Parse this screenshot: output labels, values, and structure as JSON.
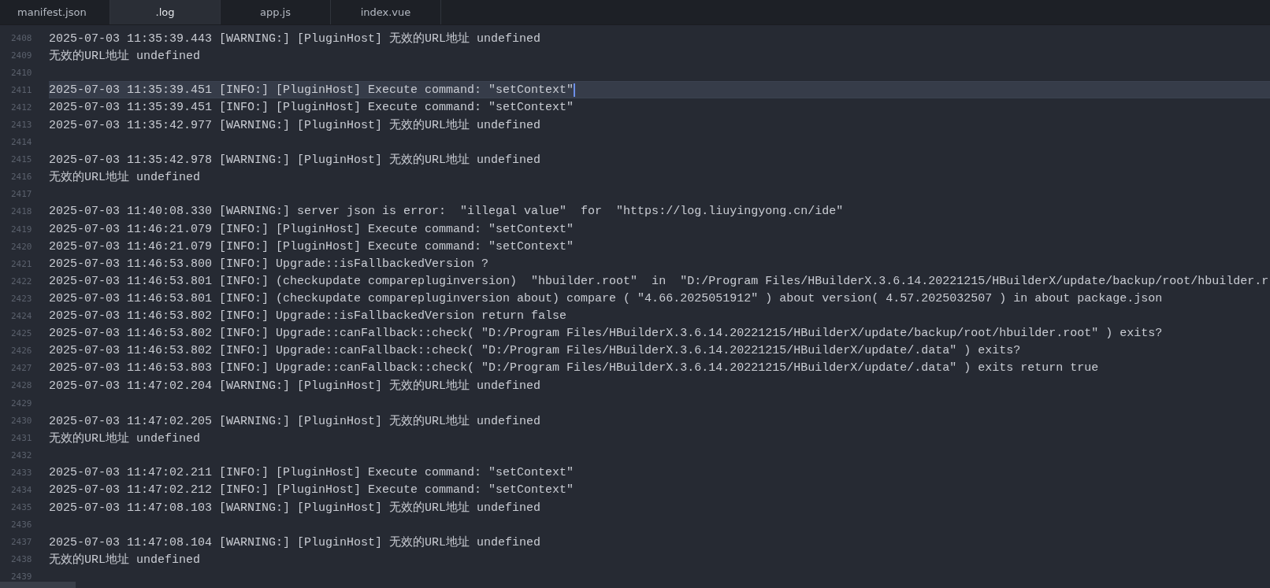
{
  "tabs": [
    {
      "label": "manifest.json",
      "selected": false
    },
    {
      "label": ".log",
      "selected": true
    },
    {
      "label": "app.js",
      "selected": false
    },
    {
      "label": "index.vue",
      "selected": false
    }
  ],
  "lines": [
    {
      "number": "2408",
      "text": "2025-07-03 11:35:39.443 [WARNING:] [PluginHost] 无效的URL地址 undefined",
      "current": false
    },
    {
      "number": "2409",
      "text": "无效的URL地址 undefined",
      "current": false
    },
    {
      "number": "2410",
      "current": false
    },
    {
      "number": "2411",
      "text": "2025-07-03 11:35:39.451 [INFO:] [PluginHost] Execute command: \"setContext\"",
      "current": true
    },
    {
      "number": "2412",
      "text": "2025-07-03 11:35:39.451 [INFO:] [PluginHost] Execute command: \"setContext\"",
      "current": false
    },
    {
      "number": "2413",
      "text": "2025-07-03 11:35:42.977 [WARNING:] [PluginHost] 无效的URL地址 undefined",
      "current": false
    },
    {
      "number": "2414",
      "current": false
    },
    {
      "number": "2415",
      "text": "2025-07-03 11:35:42.978 [WARNING:] [PluginHost] 无效的URL地址 undefined",
      "current": false
    },
    {
      "number": "2416",
      "text": "无效的URL地址 undefined",
      "current": false
    },
    {
      "number": "2417",
      "current": false
    },
    {
      "number": "2418",
      "text": "2025-07-03 11:40:08.330 [WARNING:] server json is error:  \"illegal value\"  for  \"https://log.liuyingyong.cn/ide\"",
      "current": false
    },
    {
      "number": "2419",
      "text": "2025-07-03 11:46:21.079 [INFO:] [PluginHost] Execute command: \"setContext\"",
      "current": false
    },
    {
      "number": "2420",
      "text": "2025-07-03 11:46:21.079 [INFO:] [PluginHost] Execute command: \"setContext\"",
      "current": false
    },
    {
      "number": "2421",
      "text": "2025-07-03 11:46:53.800 [INFO:] Upgrade::isFallbackedVersion ?",
      "current": false
    },
    {
      "number": "2422",
      "text": "2025-07-03 11:46:53.801 [INFO:] (checkupdate comparepluginversion)  \"hbuilder.root\"  in  \"D:/Program Files/HBuilderX.3.6.14.20221215/HBuilderX/update/backup/root/hbuilder.r",
      "current": false
    },
    {
      "number": "2423",
      "text": "2025-07-03 11:46:53.801 [INFO:] (checkupdate comparepluginversion about) compare ( \"4.66.2025051912\" ) about version( 4.57.2025032507 ) in about package.json",
      "current": false
    },
    {
      "number": "2424",
      "text": "2025-07-03 11:46:53.802 [INFO:] Upgrade::isFallbackedVersion return false",
      "current": false
    },
    {
      "number": "2425",
      "text": "2025-07-03 11:46:53.802 [INFO:] Upgrade::canFallback::check( \"D:/Program Files/HBuilderX.3.6.14.20221215/HBuilderX/update/backup/root/hbuilder.root\" ) exits?",
      "current": false
    },
    {
      "number": "2426",
      "text": "2025-07-03 11:46:53.802 [INFO:] Upgrade::canFallback::check( \"D:/Program Files/HBuilderX.3.6.14.20221215/HBuilderX/update/.data\" ) exits?",
      "current": false
    },
    {
      "number": "2427",
      "text": "2025-07-03 11:46:53.803 [INFO:] Upgrade::canFallback::check( \"D:/Program Files/HBuilderX.3.6.14.20221215/HBuilderX/update/.data\" ) exits return true",
      "current": false
    },
    {
      "number": "2428",
      "text": "2025-07-03 11:47:02.204 [WARNING:] [PluginHost] 无效的URL地址 undefined",
      "current": false
    },
    {
      "number": "2429",
      "current": false
    },
    {
      "number": "2430",
      "text": "2025-07-03 11:47:02.205 [WARNING:] [PluginHost] 无效的URL地址 undefined",
      "current": false
    },
    {
      "number": "2431",
      "text": "无效的URL地址 undefined",
      "current": false
    },
    {
      "number": "2432",
      "current": false
    },
    {
      "number": "2433",
      "text": "2025-07-03 11:47:02.211 [INFO:] [PluginHost] Execute command: \"setContext\"",
      "current": false
    },
    {
      "number": "2434",
      "text": "2025-07-03 11:47:02.212 [INFO:] [PluginHost] Execute command: \"setContext\"",
      "current": false
    },
    {
      "number": "2435",
      "text": "2025-07-03 11:47:08.103 [WARNING:] [PluginHost] 无效的URL地址 undefined",
      "current": false
    },
    {
      "number": "2436",
      "current": false
    },
    {
      "number": "2437",
      "text": "2025-07-03 11:47:08.104 [WARNING:] [PluginHost] 无效的URL地址 undefined",
      "current": false
    },
    {
      "number": "2438",
      "text": "无效的URL地址 undefined",
      "current": false
    },
    {
      "number": "2439",
      "current": false
    }
  ]
}
